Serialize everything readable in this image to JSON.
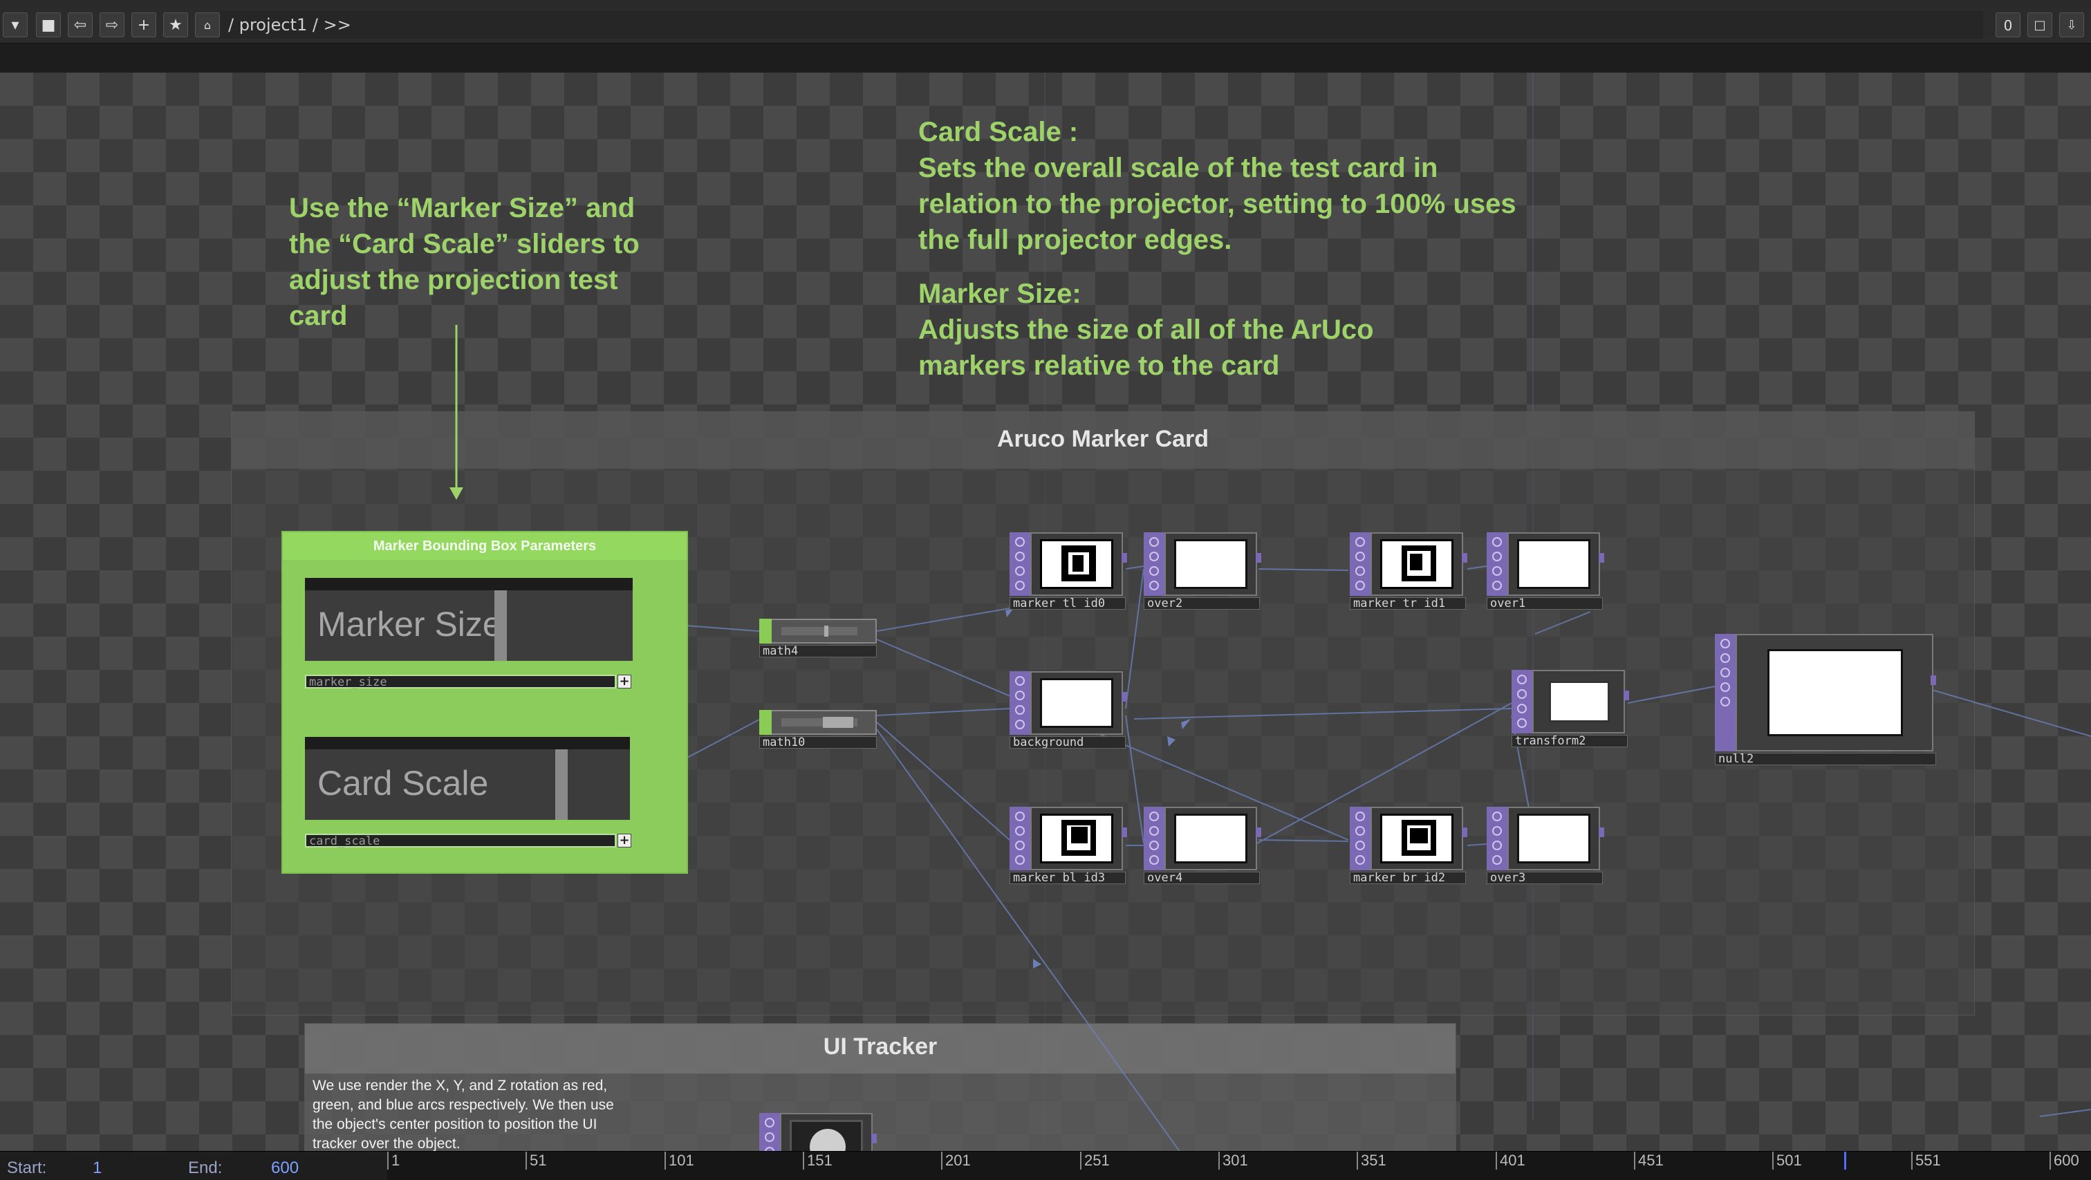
{
  "toolbar": {
    "path": "/ project1 / >>",
    "right_value": "0"
  },
  "annotations": {
    "left_note": [
      "Use the “Marker Size” and",
      "the “Card Scale” sliders to",
      "adjust the projection test",
      "card"
    ],
    "card_scale_title": "Card Scale :",
    "card_scale_text": [
      "Sets the overall scale of the test card in",
      "relation to the projector, setting to 100% uses",
      "the full projector edges."
    ],
    "marker_size_title": "Marker Size:",
    "marker_size_text": [
      "Adjusts the size of all of the ArUco",
      "markers relative to the card"
    ]
  },
  "groups": {
    "aruco_title": "Aruco Marker Card",
    "ui_tracker_title": "UI Tracker",
    "ui_tracker_text": [
      "We use render the X, Y, and Z rotation as red,",
      "green, and blue arcs respectively.  We then use",
      "the object's center position to position the UI",
      "tracker over the object."
    ]
  },
  "container": {
    "title": "Marker Bounding Box Parameters",
    "sliders": [
      {
        "label": "Marker Size",
        "param": "marker_size",
        "value": 0.6
      },
      {
        "label": "Card Scale",
        "param": "card_scale",
        "value": 0.8
      }
    ]
  },
  "chops": [
    {
      "name": "math4"
    },
    {
      "name": "math10"
    }
  ],
  "nodes": [
    {
      "name": "marker_tl_id0",
      "kind": "marker",
      "icon": "marker-tl-icon"
    },
    {
      "name": "over2",
      "kind": "card"
    },
    {
      "name": "marker_tr_id1",
      "kind": "marker",
      "icon": "marker-tr-icon"
    },
    {
      "name": "over1",
      "kind": "card"
    },
    {
      "name": "background",
      "kind": "plain"
    },
    {
      "name": "transform2",
      "kind": "card"
    },
    {
      "name": "null2",
      "kind": "card"
    },
    {
      "name": "marker_bl_id3",
      "kind": "marker",
      "icon": "marker-bl-icon"
    },
    {
      "name": "over4",
      "kind": "card"
    },
    {
      "name": "marker_br_id2",
      "kind": "marker",
      "icon": "marker-br-icon"
    },
    {
      "name": "over3",
      "kind": "card"
    }
  ],
  "timeline": {
    "start_label": "Start:",
    "start_value": "1",
    "end_label": "End:",
    "end_value": "600",
    "ticks": [
      "1",
      "51",
      "101",
      "151",
      "201",
      "251",
      "301",
      "351",
      "401",
      "451",
      "501",
      "551",
      "600"
    ],
    "playhead_frame": 526
  },
  "colors": {
    "annotation": "#9ed36a",
    "top_family": "#7b69b4",
    "chop_family": "#8acc55",
    "container": "#8ccc5c"
  }
}
